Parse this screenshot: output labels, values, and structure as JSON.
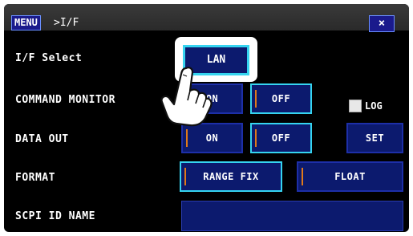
{
  "titlebar": {
    "menu_label": "MENU",
    "breadcrumb": ">I/F",
    "close_label": "×"
  },
  "rows": {
    "if_select": {
      "label": "I/F Select",
      "value": "LAN"
    },
    "command_monitor": {
      "label": "COMMAND MONITOR",
      "on": "ON",
      "off": "OFF",
      "log_label": "LOG"
    },
    "data_out": {
      "label": "DATA OUT",
      "on": "ON",
      "off": "OFF",
      "set": "SET"
    },
    "format": {
      "label": "FORMAT",
      "range_fix": "RANGE FIX",
      "float": "FLOAT"
    },
    "scpi_id": {
      "label": "SCPI ID NAME",
      "value": ""
    }
  },
  "colors": {
    "button_fill": "#0c1a6e",
    "button_border": "#1d2fa8",
    "active_border": "#35d4f0",
    "indicator": "#e07a1a",
    "background": "#000000"
  },
  "icons": {
    "touch_pointer": "pointing-hand-icon"
  }
}
